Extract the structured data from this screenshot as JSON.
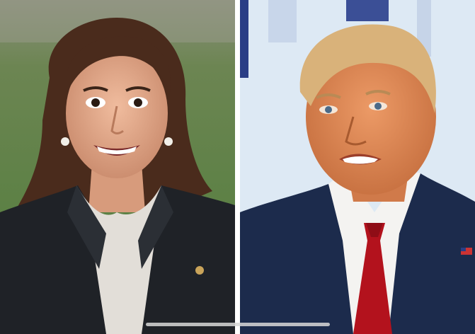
{
  "photos": [
    {
      "name": "left-portrait",
      "subject": "woman-smiling-dark-blazer",
      "background": "green-lawn"
    },
    {
      "name": "right-portrait",
      "subject": "man-white-shirt-red-tie",
      "background": "blue-white-stage"
    }
  ],
  "colors": {
    "left_bg_top": "#6f7a5c",
    "left_bg_bottom": "#5f8a45",
    "hair_left": "#4a2b1c",
    "skin_left": "#e0a889",
    "blazer": "#1f2227",
    "blouse": "#e2ded8",
    "right_bg": "#dde9f4",
    "right_bg_stripe": "#2a3e86",
    "hair_right": "#d9b27a",
    "skin_right": "#e08b59",
    "suit_right": "#1c2b4c",
    "shirt": "#f4f3f1",
    "tie": "#b3121d",
    "divider": "#ffffff"
  }
}
